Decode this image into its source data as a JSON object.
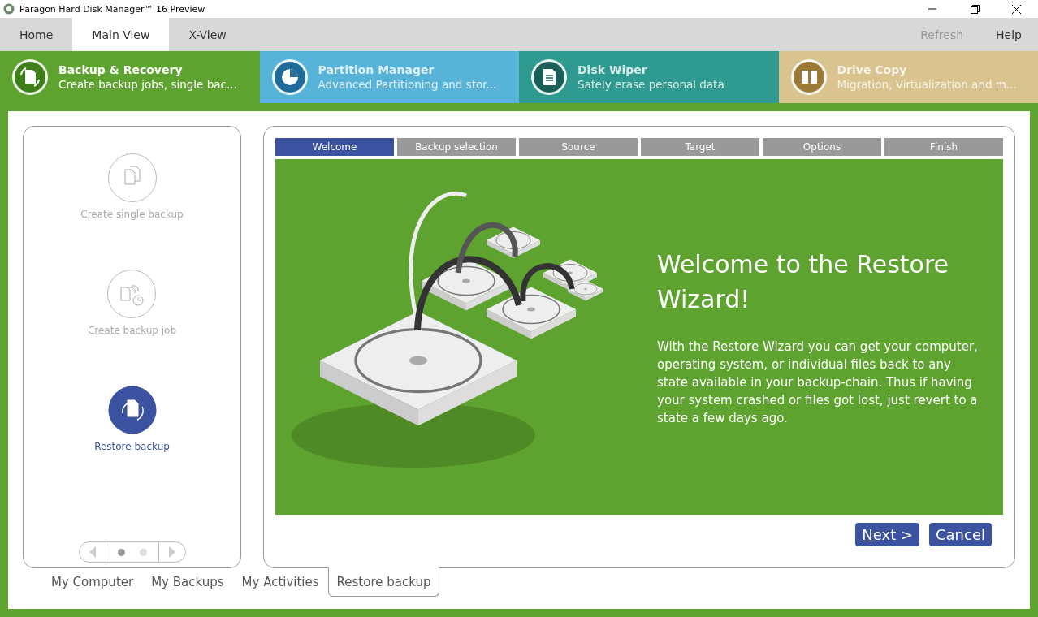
{
  "window": {
    "title": "Paragon Hard Disk Manager™ 16 Preview"
  },
  "tabs": [
    {
      "label": "Home",
      "selected": false
    },
    {
      "label": "Main View",
      "selected": true
    },
    {
      "label": "X-View",
      "selected": false
    }
  ],
  "toolbar": [
    {
      "label": "Refresh",
      "disabled": true
    },
    {
      "label": "Help",
      "disabled": false
    }
  ],
  "modules": [
    {
      "title": "Backup & Recovery",
      "subtitle": "Create backup jobs, single bac...",
      "color": "#5ea22f",
      "selected": true
    },
    {
      "title": "Partition Manager",
      "subtitle": "Advanced Partitioning and stor...",
      "color": "#58b3d8",
      "selected": false
    },
    {
      "title": "Disk Wiper",
      "subtitle": "Safely erase personal data",
      "color": "#2f9a8f",
      "selected": false
    },
    {
      "title": "Drive Copy",
      "subtitle": "Migration, Virtualization and m...",
      "color": "#d9c38e",
      "selected": false
    }
  ],
  "actions": [
    {
      "label": "Create single backup",
      "kind": "single",
      "selected": false
    },
    {
      "label": "Create backup job",
      "kind": "job",
      "selected": false
    },
    {
      "label": "Restore backup",
      "kind": "restore",
      "selected": true
    }
  ],
  "pager": {
    "pages": [
      {
        "selected": true
      },
      {
        "selected": false
      }
    ]
  },
  "steps": [
    {
      "label": "Welcome",
      "selected": true
    },
    {
      "label": "Backup selection",
      "selected": false
    },
    {
      "label": "Source",
      "selected": false
    },
    {
      "label": "Target",
      "selected": false
    },
    {
      "label": "Options",
      "selected": false
    },
    {
      "label": "Finish",
      "selected": false
    }
  ],
  "welcome": {
    "heading": "Welcome to the Restore Wizard!",
    "body": "With the Restore Wizard you can get your computer, operating system, or individual files back to any state available in your backup-chain. Thus if having your system crashed or files got lost, just revert to a state a few days ago."
  },
  "buttons": [
    "Next >",
    "Cancel"
  ],
  "bottom_tabs": [
    {
      "label": "My Computer",
      "selected": false
    },
    {
      "label": "My Backups",
      "selected": false
    },
    {
      "label": "My Activities",
      "selected": false
    },
    {
      "label": "Restore backup",
      "selected": true
    }
  ]
}
